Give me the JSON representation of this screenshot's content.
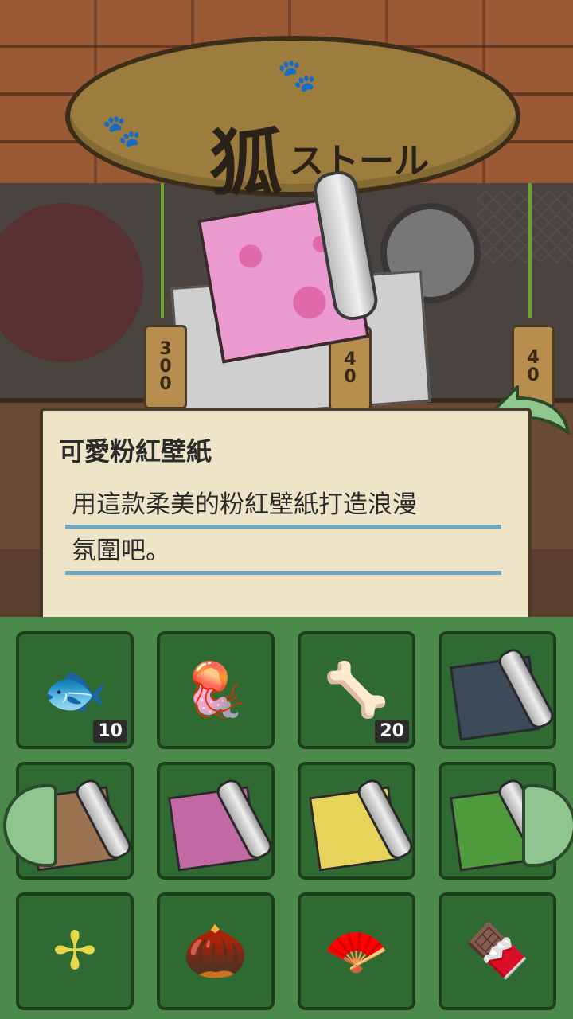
{
  "shop": {
    "sign_kanji": "狐",
    "sign_kana": "ストール",
    "price_tags": [
      {
        "digits": [
          "3",
          "0",
          "0"
        ]
      },
      {
        "digits": [
          "4",
          "0"
        ]
      },
      {
        "digits": [
          "4",
          "0"
        ]
      }
    ]
  },
  "dialog": {
    "title": "可愛粉紅壁紙",
    "line1": "用這款柔美的粉紅壁紙打造浪漫",
    "line2": "氛圍吧。"
  },
  "inventory": {
    "items": [
      {
        "icon": "anglerfish-icon",
        "glyph": "🐟",
        "count": "10"
      },
      {
        "icon": "jellyfish-icon",
        "glyph": "🪼"
      },
      {
        "icon": "fish-bone-icon",
        "glyph": "🦴",
        "count": "20"
      },
      {
        "icon": "dark-wallpaper-icon",
        "color": "#3d4a59"
      },
      {
        "icon": "wood-wallpaper-icon",
        "color": "#9a7350"
      },
      {
        "icon": "pink-wallpaper-icon",
        "color": "#c36aa5"
      },
      {
        "icon": "banana-wallpaper-icon",
        "color": "#e6d35a"
      },
      {
        "icon": "leaf-wallpaper-icon",
        "color": "#4e9a3c"
      },
      {
        "icon": "pinwheel-icon",
        "glyph": "✢"
      },
      {
        "icon": "acorn-icon",
        "glyph": "🌰"
      },
      {
        "icon": "folding-fan-icon",
        "glyph": "🪭"
      },
      {
        "icon": "snack-box-icon",
        "glyph": "🍫"
      }
    ]
  },
  "colors": {
    "inventory_bg": "#4b8a4b",
    "cell_bg": "#2f6a32",
    "dialog_bg": "#eee4c8",
    "underline": "#6ea7bf",
    "arrow": "#8fc58f"
  }
}
